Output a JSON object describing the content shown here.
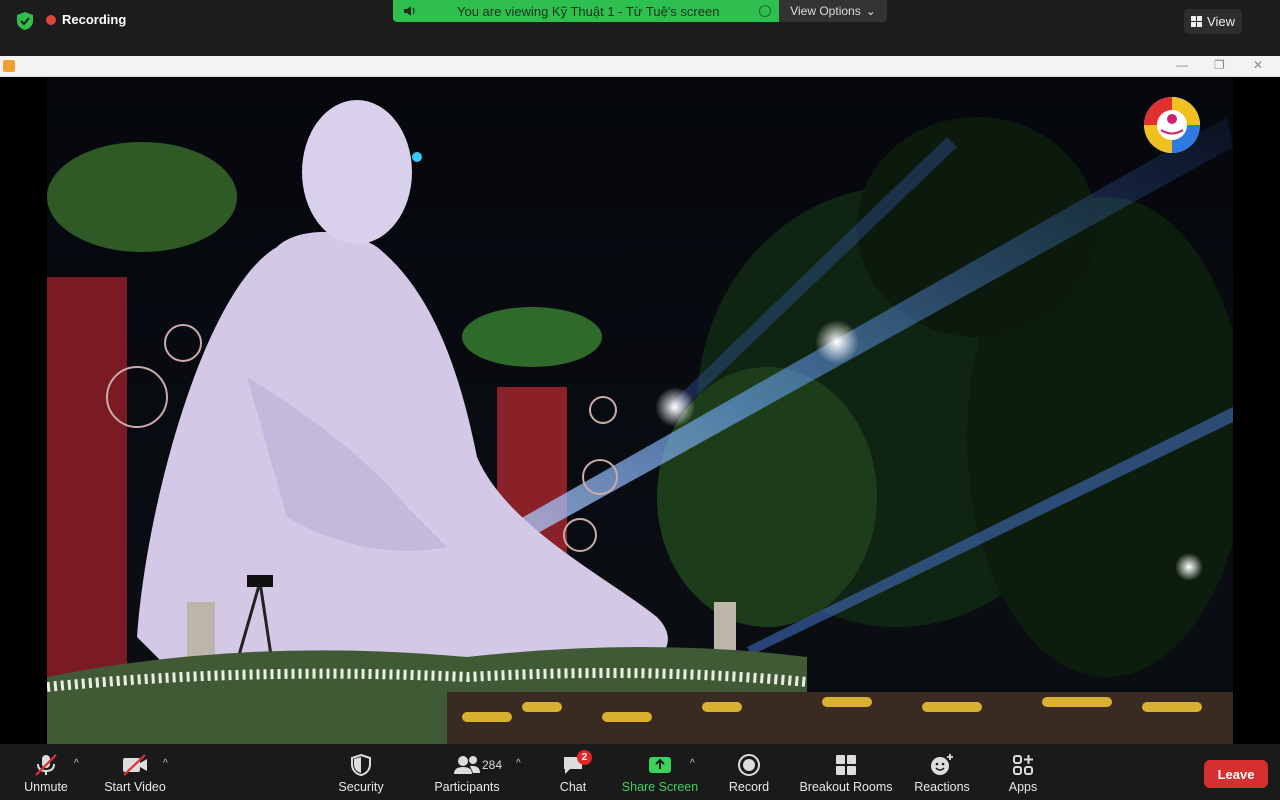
{
  "top": {
    "recording_label": "Recording",
    "viewing_text": "You are viewing Kỹ Thuật 1  - Từ Tuệ's screen",
    "view_options_label": "View Options",
    "view_label": "View"
  },
  "toolbar": {
    "unmute_label": "Unmute",
    "start_video_label": "Start Video",
    "security_label": "Security",
    "participants_label": "Participants",
    "participants_count": "284",
    "chat_label": "Chat",
    "chat_badge": "2",
    "share_label": "Share Screen",
    "record_label": "Record",
    "breakout_label": "Breakout Rooms",
    "reactions_label": "Reactions",
    "apps_label": "Apps",
    "leave_label": "Leave"
  },
  "colors": {
    "accent_green": "#2fbf4e",
    "leave_red": "#d62f2f",
    "share_green": "#3cd35c"
  }
}
